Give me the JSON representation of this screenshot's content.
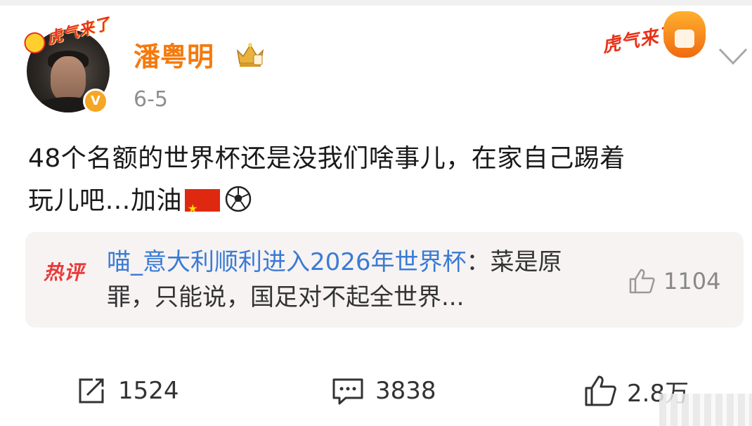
{
  "post": {
    "author": "潘粤明",
    "date": "6-5",
    "avatar_banner": "虎气来了",
    "verified_mark": "V",
    "promo_badge": "虎气来了",
    "text_line1": "48个名额的世界杯还是没我们啥事儿，在家自己踢着",
    "text_line2": "玩儿吧…加油",
    "emojis": [
      "china-flag-icon",
      "soccer-ball-icon"
    ]
  },
  "hot_comment": {
    "tag": "热评",
    "author": "喵_意大利顺利进入2026年世界杯",
    "separator": "：",
    "text": "菜是原罪，只能说，国足对不起全世界...",
    "like_count": "1104"
  },
  "actions": {
    "repost_count": "1524",
    "comment_count": "3838",
    "like_count": "2.8万"
  },
  "colors": {
    "username": "#f57a0c",
    "comment_author": "#3a7bd5",
    "hot_tag": "#e83a3a",
    "hot_comment_bg": "#f7f3f3"
  }
}
